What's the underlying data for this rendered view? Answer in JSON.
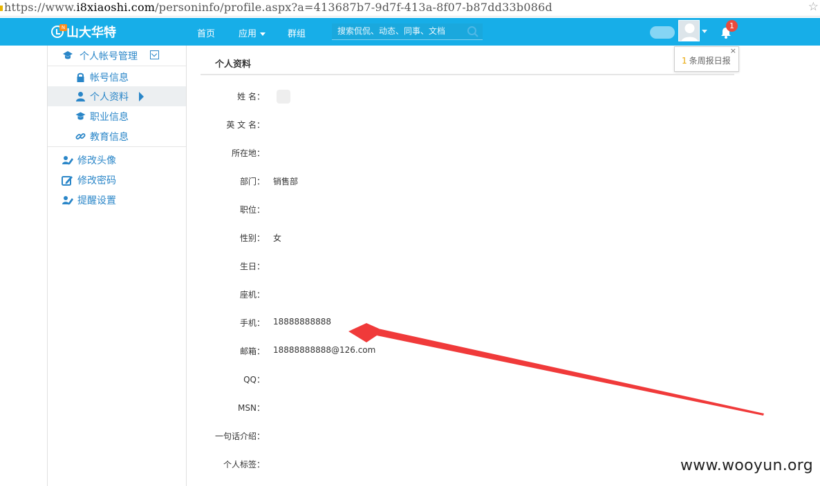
{
  "browser": {
    "url_prefix": "https://www.",
    "url_host": "i8xiaoshi.com",
    "url_path": "/personinfo/profile.aspx?a=413687b7-9d7f-413a-8f07-b87dd33b086d",
    "star_icon": "star-icon"
  },
  "header": {
    "logo_text": "山大华特",
    "logo_badge": "N",
    "nav": [
      {
        "label": "首页"
      },
      {
        "label": "应用"
      },
      {
        "label": "群组"
      }
    ],
    "search_placeholder": "搜索侃侃、动态、同事、文档",
    "notification_count": "1",
    "brand_color": "#17aee8"
  },
  "popup": {
    "count": "1",
    "text": "条周报日报",
    "close": "×"
  },
  "sidebar": {
    "section_label": "个人帐号管理",
    "sub_items": [
      {
        "label": "帐号信息",
        "icon": "lock-icon"
      },
      {
        "label": "个人资料",
        "icon": "user-icon"
      },
      {
        "label": "职业信息",
        "icon": "briefcase-icon"
      },
      {
        "label": "教育信息",
        "icon": "link-icon"
      }
    ],
    "items": [
      {
        "label": "修改头像",
        "icon": "edit-avatar-icon"
      },
      {
        "label": "修改密码",
        "icon": "edit-password-icon"
      },
      {
        "label": "提醒设置",
        "icon": "edit-reminder-icon"
      }
    ],
    "link_color": "#2a86c8"
  },
  "profile": {
    "title": "个人资料",
    "fields": [
      {
        "label": "姓 名：",
        "value": ""
      },
      {
        "label": "英 文 名：",
        "value": ""
      },
      {
        "label": "所在地：",
        "value": ""
      },
      {
        "label": "部门：",
        "value": "销售部"
      },
      {
        "label": "职位：",
        "value": ""
      },
      {
        "label": "性别：",
        "value": "女"
      },
      {
        "label": "生日：",
        "value": ""
      },
      {
        "label": "座机：",
        "value": ""
      },
      {
        "label": "手机：",
        "value": "18888888888"
      },
      {
        "label": "邮箱：",
        "value": "18888888888@126.com"
      },
      {
        "label": "QQ：",
        "value": ""
      },
      {
        "label": "MSN：",
        "value": ""
      },
      {
        "label": "一句话介绍：",
        "value": ""
      },
      {
        "label": "个人标签：",
        "value": ""
      }
    ]
  },
  "annotation": {
    "arrow_color": "#f03a3a"
  },
  "watermark": "www.wooyun.org"
}
